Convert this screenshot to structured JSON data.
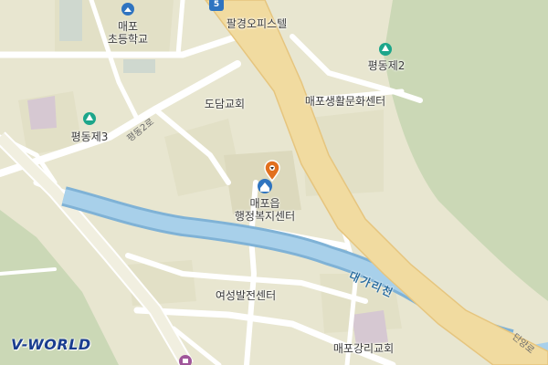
{
  "labels": {
    "school": "매포\n초등학교",
    "officetel": "팔경오피스텔",
    "park2": "평동제2",
    "park3": "평동제3",
    "church_dodam": "도담교회",
    "culture_center": "매포생활문화센터",
    "welfare_center": "매포읍\n행정복지센터",
    "river": "대가리천",
    "women_center": "여성발전센터",
    "church_ganglee": "매포강리교회",
    "road_pyeongdong2": "평동2로",
    "road_danyang": "단양로",
    "route_badge": "5"
  },
  "logo": "V-WORLD",
  "icons": {
    "school": "school-icon",
    "park": "park-icon",
    "welfare_center": "government-office-icon",
    "selected": "location-pin-icon",
    "hospital": "medical-icon"
  },
  "colors": {
    "land": "#e8e6d0",
    "forest": "#c9d7b4",
    "road": "#ffffff",
    "highway": "#f2dca0",
    "river": "#9fc8e6",
    "park": "#1ca68a",
    "pin": "#e2701e",
    "logo": "#1a3d8f"
  }
}
